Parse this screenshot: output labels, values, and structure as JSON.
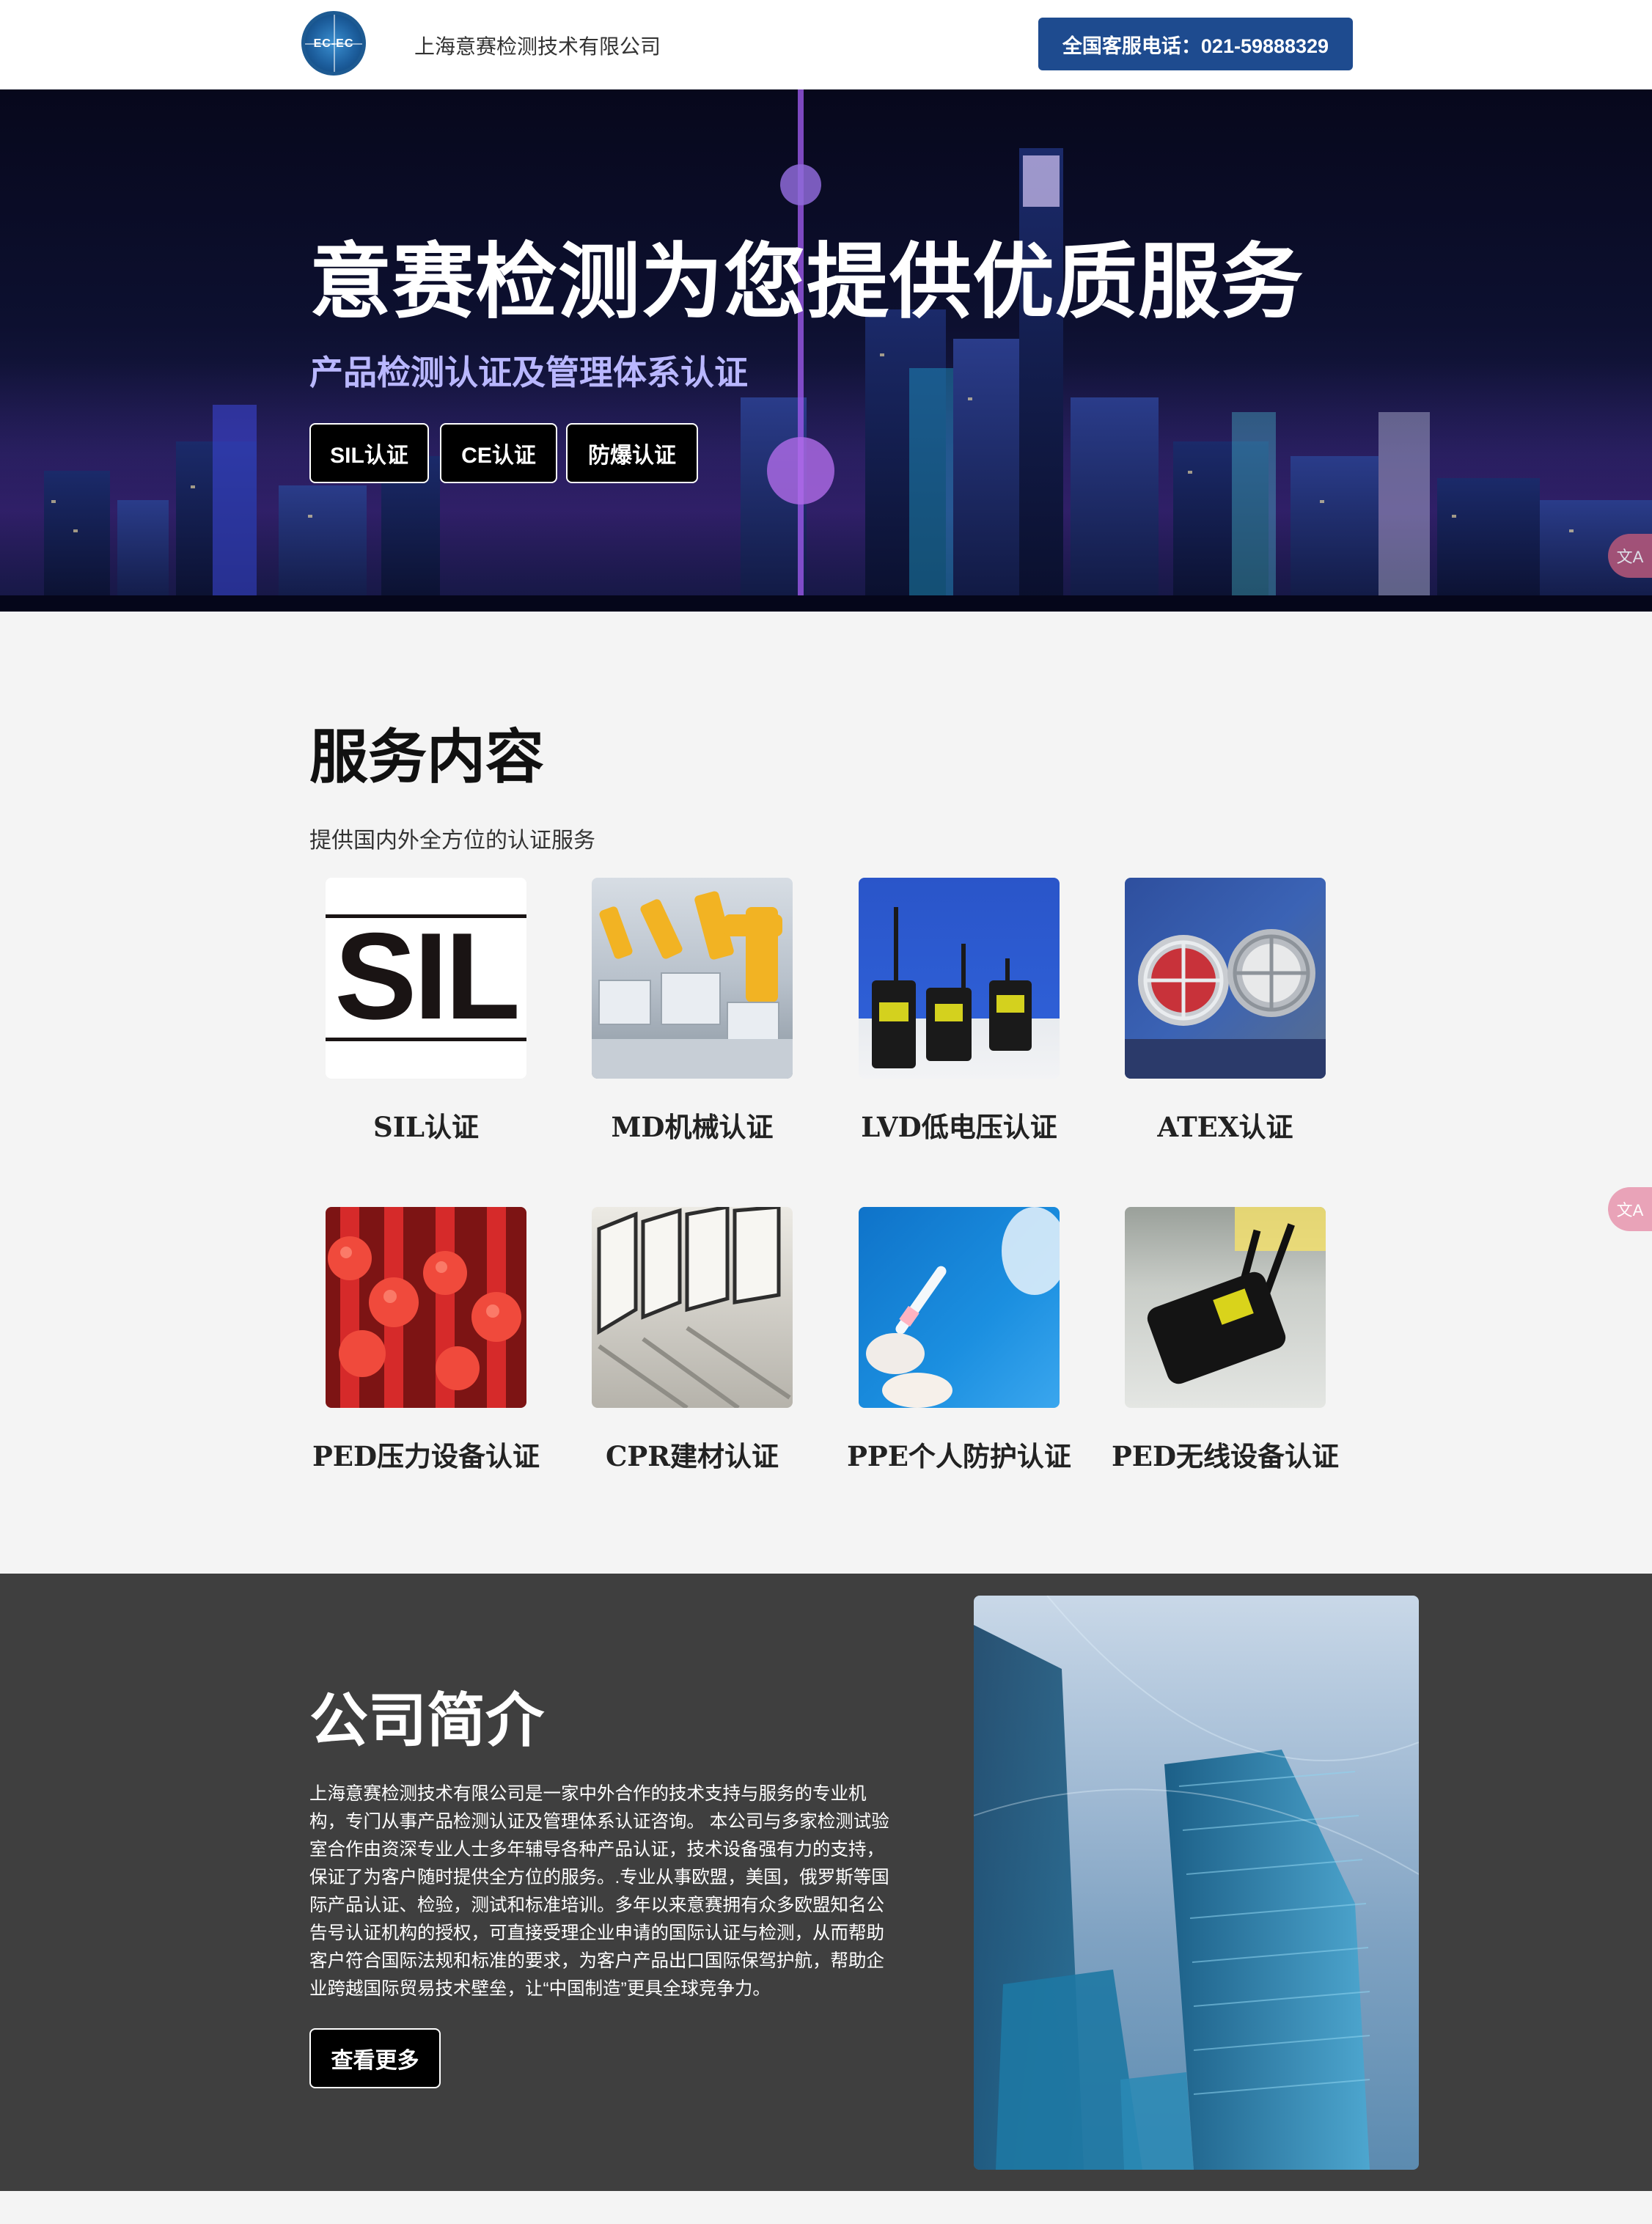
{
  "header": {
    "logo_text": "EC-EC",
    "company_name": "上海意赛检测技术有限公司",
    "hotline": "全国客服电话：021-59888329"
  },
  "hero": {
    "title": "意赛检测为您提供优质服务",
    "subtitle": "产品检测认证及管理体系认证",
    "buttons": [
      "SIL认证",
      "CE认证",
      "防爆认证"
    ]
  },
  "floating": {
    "translate_icon": "文A"
  },
  "services": {
    "title": "服务内容",
    "subtitle": "提供国内外全方位的认证服务",
    "thumb_sil_text": "SIL",
    "items": [
      {
        "label": "SIL认证",
        "icon": "sil-logo"
      },
      {
        "label": "MD机械认证",
        "icon": "robot-arms-image"
      },
      {
        "label": "LVD低电压认证",
        "icon": "radio-devices-image"
      },
      {
        "label": "ATEX认证",
        "icon": "explosion-proof-lamps-image"
      },
      {
        "label": "PED压力设备认证",
        "icon": "red-valves-image"
      },
      {
        "label": "CPR建材认证",
        "icon": "glass-panels-image"
      },
      {
        "label": "PPE个人防护认证",
        "icon": "medical-test-image"
      },
      {
        "label": "PED无线设备认证",
        "icon": "wireless-device-image"
      }
    ]
  },
  "about": {
    "title": "公司简介",
    "paragraph": "上海意赛检测技术有限公司是一家中外合作的技术支持与服务的专业机构，专门从事产品检测认证及管理体系认证咨询。 本公司与多家检测试验室合作由资深专业人士多年辅导各种产品认证，技术设备强有力的支持，保证了为客户随时提供全方位的服务。.专业从事欧盟，美国，俄罗斯等国际产品认证、检验，测试和标准培训。多年以来意赛拥有众多欧盟知名公告号认证机构的授权，可直接受理企业申请的国际认证与检测，从而帮助客户符合国际法规和标准的要求，为客户产品出口国际保驾护航，帮助企业跨越国际贸易技术壁垒，让“中国制造”更具全球竞争力。",
    "button": "查看更多"
  },
  "colors": {
    "header_button": "#1e4b8f",
    "hero_subtitle": "#b9b7ff",
    "about_bg": "#3f3f3f",
    "translate_float": "#e9a3b8"
  }
}
